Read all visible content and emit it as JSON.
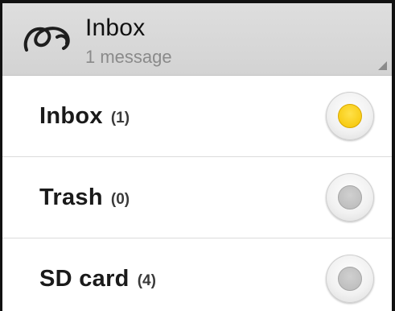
{
  "header": {
    "icon": "mail-loop-icon",
    "title": "Inbox",
    "subtitle": "1 message"
  },
  "folders": [
    {
      "name": "Inbox",
      "count": "(1)",
      "selected": true
    },
    {
      "name": "Trash",
      "count": "(0)",
      "selected": false
    },
    {
      "name": "SD card",
      "count": "(4)",
      "selected": false
    }
  ],
  "colors": {
    "selected_radio": "#f5c400",
    "unselected_radio": "#bcbcbc",
    "header_bg": "#d8d8d8"
  }
}
